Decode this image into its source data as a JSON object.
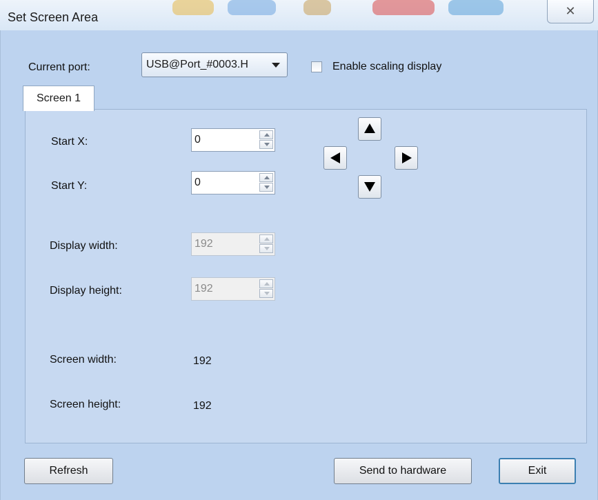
{
  "window": {
    "title": "Set Screen Area",
    "close_icon": "close-icon"
  },
  "port": {
    "label": "Current port:",
    "selected": "USB@Port_#0003.H"
  },
  "scaling": {
    "label": "Enable scaling display",
    "checked": false
  },
  "tabs": [
    {
      "label": "Screen 1",
      "active": true
    }
  ],
  "fields": {
    "start_x": {
      "label": "Start X:",
      "value": "0",
      "enabled": true
    },
    "start_y": {
      "label": "Start Y:",
      "value": "0",
      "enabled": true
    },
    "display_width": {
      "label": "Display width:",
      "value": "192",
      "enabled": false
    },
    "display_height": {
      "label": "Display height:",
      "value": "192",
      "enabled": false
    }
  },
  "screen": {
    "width_label": "Screen width:",
    "width_value": "192",
    "height_label": "Screen height:",
    "height_value": "192"
  },
  "arrows": [
    "up-arrow-icon",
    "left-arrow-icon",
    "right-arrow-icon",
    "down-arrow-icon"
  ],
  "buttons": {
    "refresh": "Refresh",
    "send": "Send to hardware",
    "exit": "Exit"
  },
  "colors": {
    "panel": "#c7d9f1",
    "client": "#bdd3ef",
    "default_border": "#3c7fb1"
  }
}
